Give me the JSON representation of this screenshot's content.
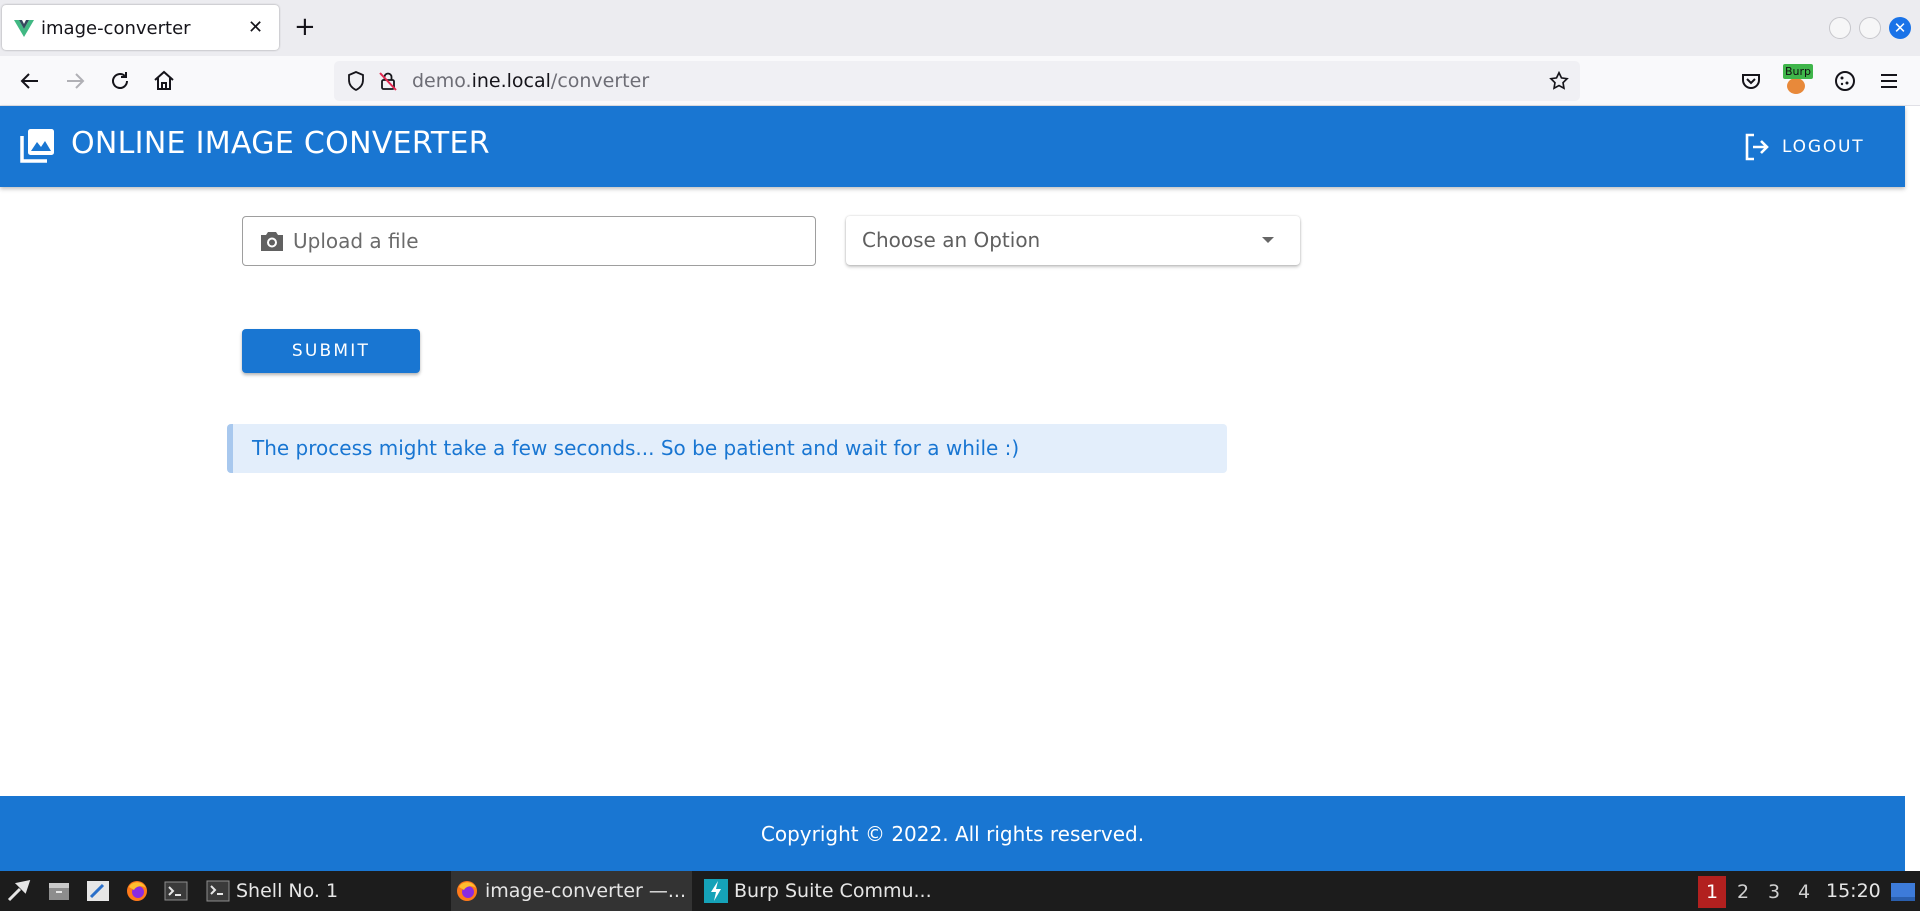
{
  "browser": {
    "tab_title": "image-converter",
    "tab_close": "✕",
    "new_tab": "+",
    "url_prefix": "demo.",
    "url_host": "ine.local",
    "url_path": "/converter",
    "window_close": "✕",
    "extension_badge": "Burp"
  },
  "header": {
    "title": "ONLINE IMAGE CONVERTER",
    "logout_label": "LOGOUT"
  },
  "form": {
    "upload_placeholder": "Upload a file",
    "select_placeholder": "Choose an Option",
    "submit_label": "SUBMIT"
  },
  "alert": {
    "message": "The process might take a few seconds... So be patient and wait for a while :)"
  },
  "footer": {
    "copyright": "Copyright © 2022. All rights reserved."
  },
  "taskbar": {
    "items": [
      {
        "label": "Shell No. 1"
      },
      {
        "label": "image-converter —..."
      },
      {
        "label": "Burp Suite Commu..."
      }
    ],
    "workspaces": [
      "1",
      "2",
      "3",
      "4"
    ],
    "clock": "15:20"
  },
  "colors": {
    "primary": "#1976d2",
    "alert_bg": "#e3eefb",
    "taskbar_bg": "#1c1c1c",
    "workspace_active": "#b2201f"
  }
}
